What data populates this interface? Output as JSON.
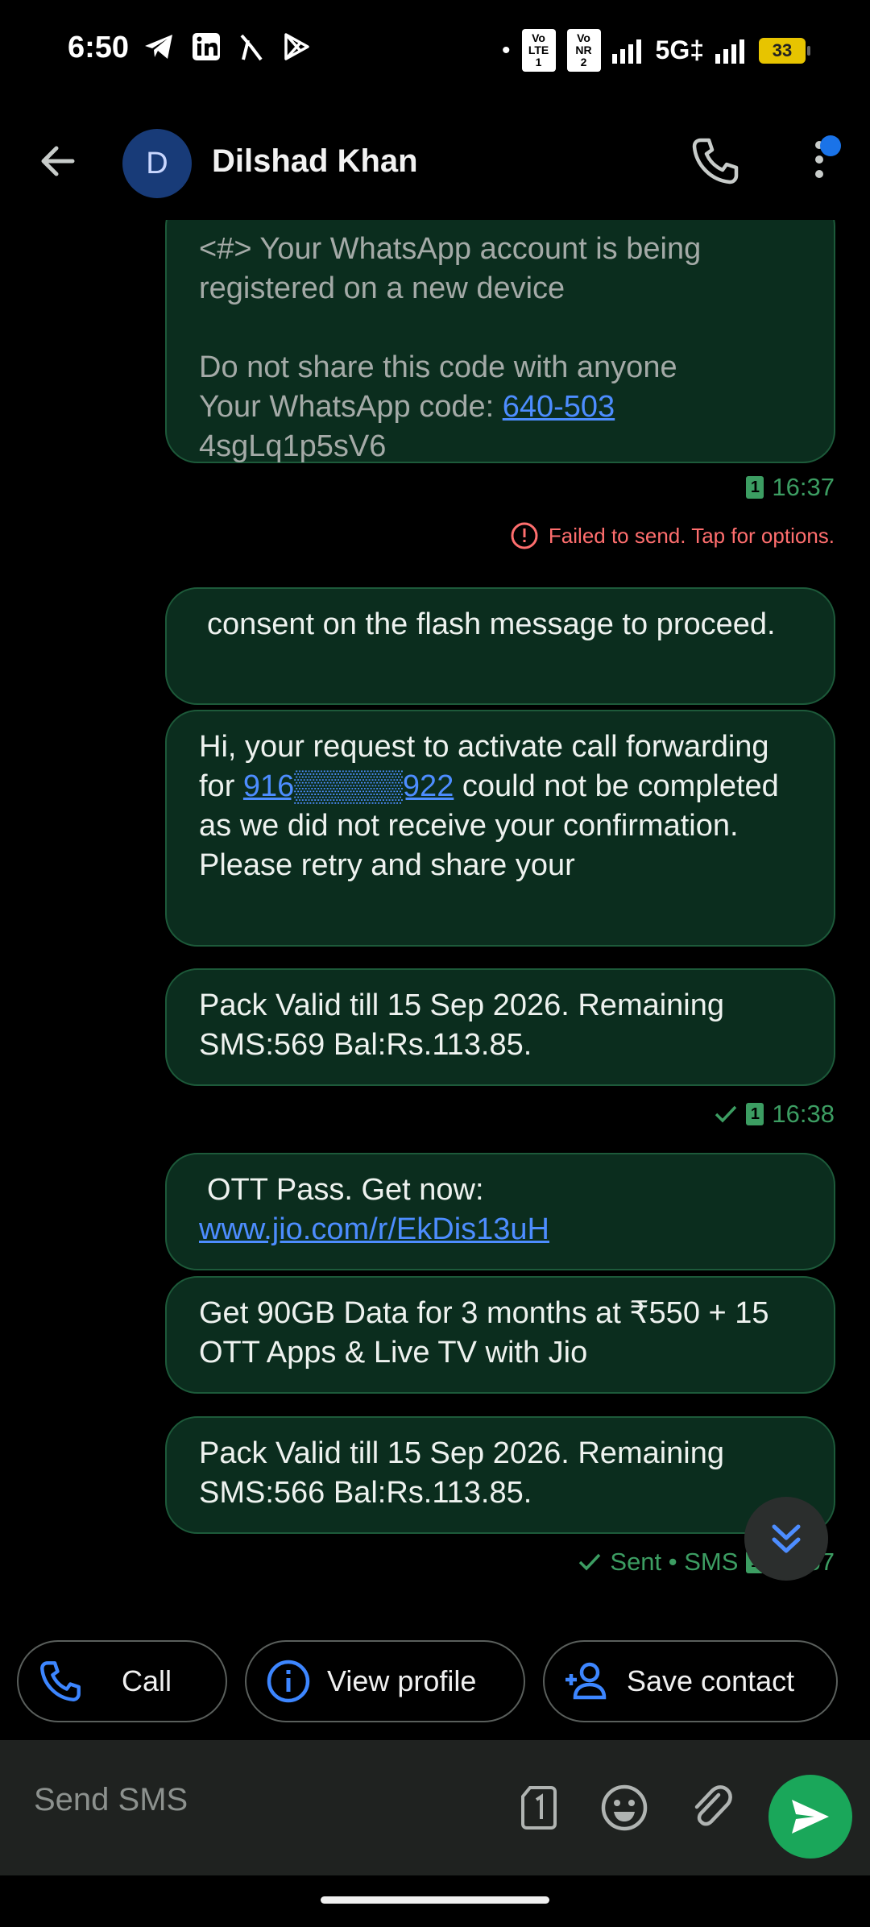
{
  "status_bar": {
    "time": "6:50",
    "sim1_label": "Vo LTE 1",
    "sim2_label": "Vo NR 2",
    "network": "5G‡",
    "battery": "33"
  },
  "header": {
    "avatar_letter": "D",
    "contact_name": "Dilshad Khan"
  },
  "messages": [
    {
      "lines": [
        "<#> Your WhatsApp account is being",
        "registered on a new device"
      ],
      "extra": [
        "Do not share this code with anyone"
      ],
      "code_prefix": "Your WhatsApp code: ",
      "code": "640-503",
      "tail": "4sgLq1p5sV6"
    },
    {
      "text": "consent on the flash message to proceed."
    },
    {
      "pre": "Hi, your request to activate call forwarding for ",
      "number": "916▒▒▒▒▒922",
      "post": " could not be completed as we did not receive your confirmation. Please retry and share your"
    },
    {
      "text": "Pack Valid till 15 Sep 2026. Remaining SMS:569 Bal:Rs.113.85."
    },
    {
      "pre": "OTT Pass. Get now: ",
      "link": "www.jio.com/r/EkDis13uH"
    },
    {
      "text": "Get 90GB Data for 3 months at ₹550 + 15 OTT Apps & Live TV with Jio"
    },
    {
      "text": "Pack Valid till 15 Sep 2026. Remaining SMS:566 Bal:Rs.113.85."
    }
  ],
  "meta": {
    "time1": "16:37",
    "failed": "Failed to send. Tap for options.",
    "time2": "16:38",
    "status_last": "Sent • SMS",
    "time3": "16:57"
  },
  "sim_badge": "1",
  "quick_actions": {
    "call": "Call",
    "view_profile": "View profile",
    "save_contact": "Save contact"
  },
  "composer": {
    "placeholder": "Send SMS"
  },
  "colors": {
    "bubble": "#0b2d1e",
    "accent_green": "#3c9d62",
    "link": "#4d8dff",
    "error": "#ff6e6e",
    "send": "#1aa75a"
  }
}
